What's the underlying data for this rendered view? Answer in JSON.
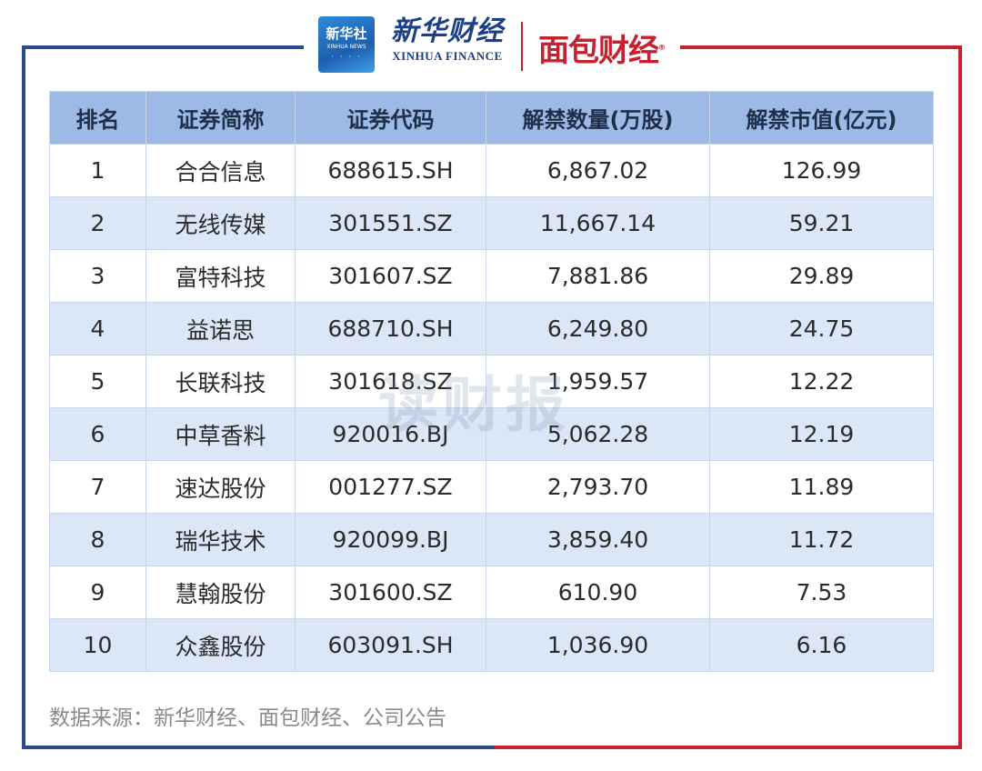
{
  "header": {
    "xinhua_badge_cn": "新华社",
    "xinhua_badge_en": "XINHUA NEWS",
    "xinhua_finance_cn": "新华财经",
    "xinhua_finance_en": "XINHUA FINANCE",
    "mianbao_logo": "面包财经"
  },
  "table": {
    "headers": [
      "排名",
      "证券简称",
      "证券代码",
      "解禁数量(万股)",
      "解禁市值(亿元)"
    ],
    "rows": [
      [
        "1",
        "合合信息",
        "688615.SH",
        "6,867.02",
        "126.99"
      ],
      [
        "2",
        "无线传媒",
        "301551.SZ",
        "11,667.14",
        "59.21"
      ],
      [
        "3",
        "富特科技",
        "301607.SZ",
        "7,881.86",
        "29.89"
      ],
      [
        "4",
        "益诺思",
        "688710.SH",
        "6,249.80",
        "24.75"
      ],
      [
        "5",
        "长联科技",
        "301618.SZ",
        "1,959.57",
        "12.22"
      ],
      [
        "6",
        "中草香料",
        "920016.BJ",
        "5,062.28",
        "12.19"
      ],
      [
        "7",
        "速达股份",
        "001277.SZ",
        "2,793.70",
        "11.89"
      ],
      [
        "8",
        "瑞华技术",
        "920099.BJ",
        "3,859.40",
        "11.72"
      ],
      [
        "9",
        "慧翰股份",
        "301600.SZ",
        "610.90",
        "7.53"
      ],
      [
        "10",
        "众鑫股份",
        "603091.SH",
        "1,036.90",
        "6.16"
      ]
    ]
  },
  "watermark": "读财报",
  "source": "数据来源：新华财经、面包财经、公司公告",
  "colors": {
    "header_bg": "#9db9e6",
    "stripe_bg": "#dbe6f7",
    "frame_blue": "#2a4b8d",
    "frame_red": "#c8202f"
  }
}
